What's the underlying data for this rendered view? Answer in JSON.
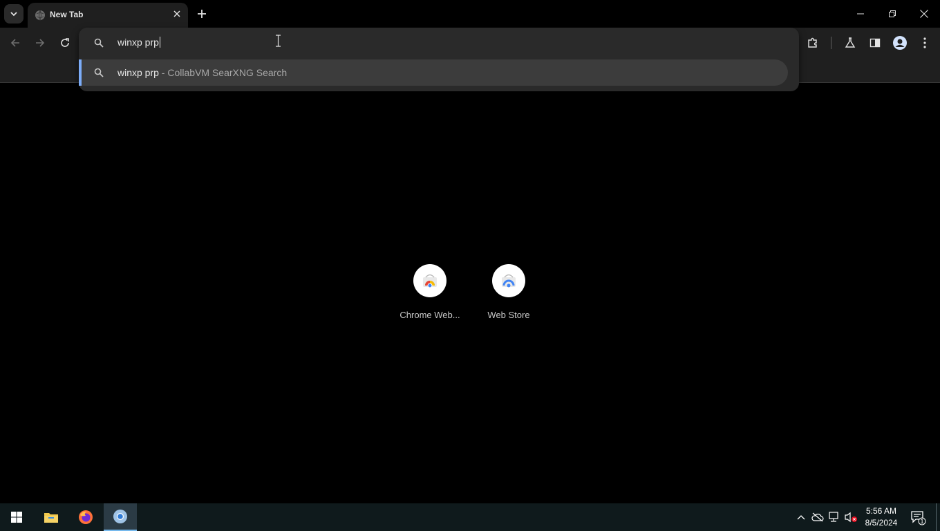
{
  "tab": {
    "title": "New Tab"
  },
  "omnibox": {
    "input_value": "winxp prp",
    "suggestion": {
      "query": "winxp prp",
      "separator": " - ",
      "engine": "CollabVM SearXNG Search"
    }
  },
  "shortcuts": [
    {
      "label": "Chrome Web...",
      "icon": "chrome-web-store-icon"
    },
    {
      "label": "Web Store",
      "icon": "web-store-icon"
    }
  ],
  "taskbar": {
    "apps": [
      "windows-start-icon",
      "file-explorer-icon",
      "firefox-icon",
      "chrome-icon"
    ],
    "clock_time": "5:56 AM",
    "clock_date": "8/5/2024",
    "notification_count": "1"
  },
  "colors": {
    "background": "#000000",
    "toolbar": "#1f1f1f",
    "omnibox": "#2a2a2a",
    "suggestion_highlight": "#3c3c3c",
    "accent": "#7cacf8",
    "taskbar": "#0f1a1c"
  }
}
